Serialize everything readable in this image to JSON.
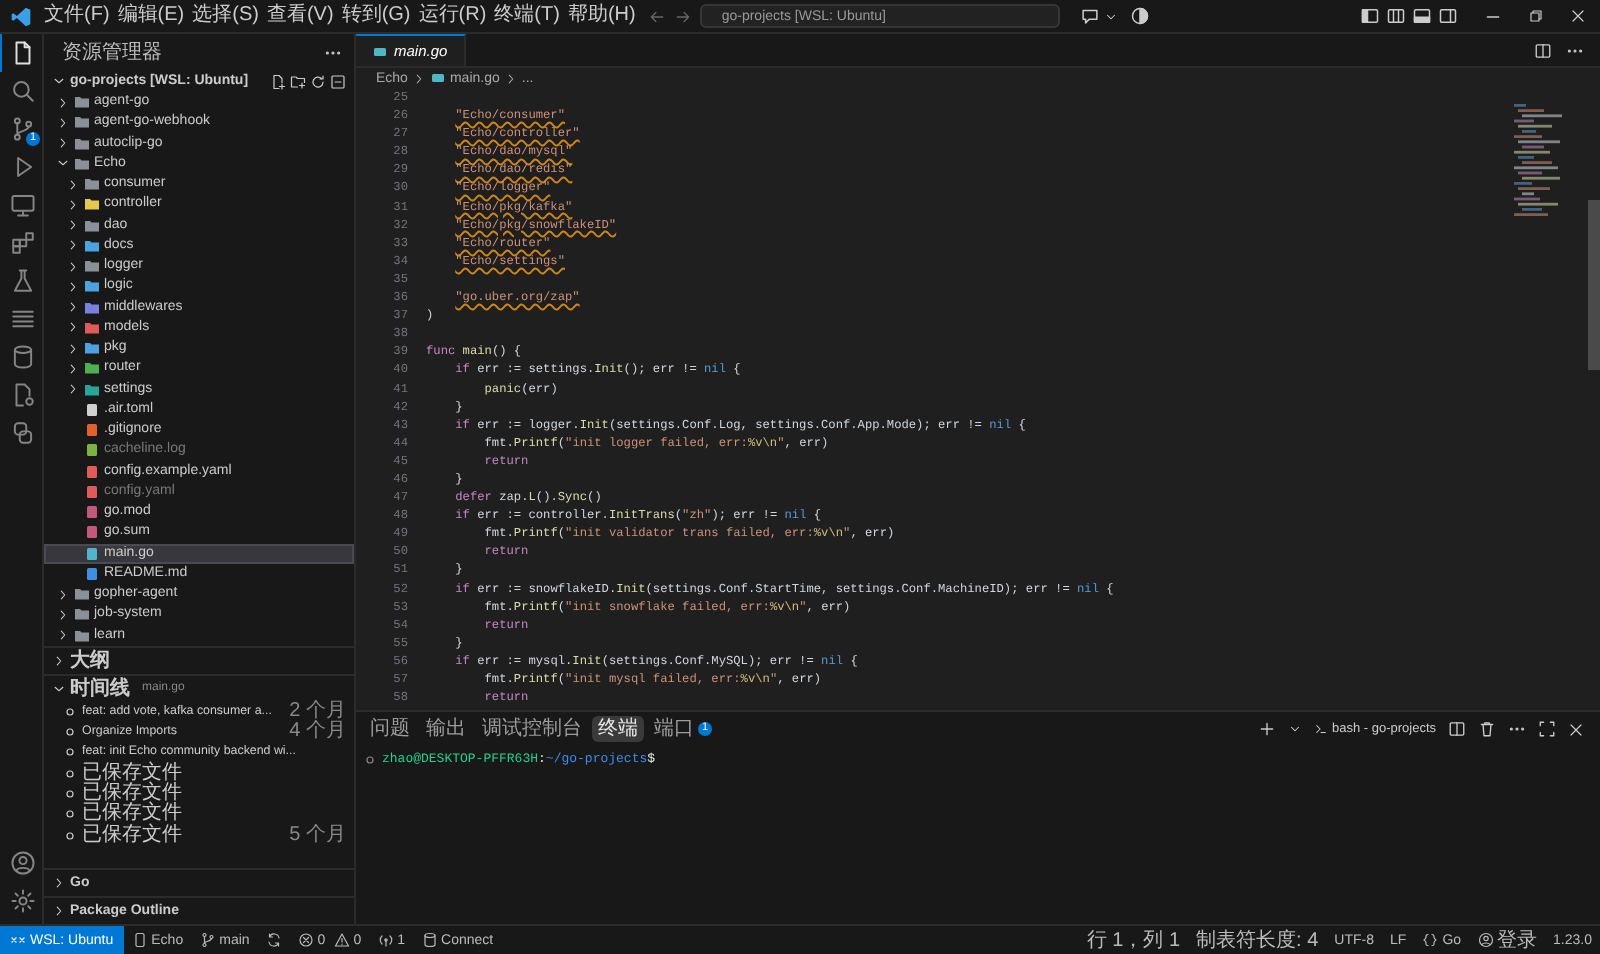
{
  "title_bar": {
    "menu": [
      "文件(F)",
      "编辑(E)",
      "选择(S)",
      "查看(V)",
      "转到(G)",
      "运行(R)",
      "终端(T)",
      "帮助(H)"
    ],
    "command_center": "go-projects [WSL: Ubuntu]"
  },
  "activity_bar": {
    "top": [
      {
        "kind": "explorer",
        "selected": true
      },
      {
        "kind": "search",
        "selected": false
      },
      {
        "kind": "source-control",
        "selected": false,
        "badge": "1"
      },
      {
        "kind": "run-debug",
        "selected": false
      },
      {
        "kind": "remote-explorer",
        "selected": false
      },
      {
        "kind": "extensions",
        "selected": false
      },
      {
        "kind": "testing",
        "selected": false
      },
      {
        "kind": "list",
        "selected": false
      },
      {
        "kind": "database",
        "selected": false
      },
      {
        "kind": "file-settings",
        "selected": false
      },
      {
        "kind": "two-squares",
        "selected": false
      }
    ],
    "bottom": [
      {
        "kind": "account",
        "selected": false
      },
      {
        "kind": "settings",
        "selected": false
      }
    ]
  },
  "sidebar": {
    "title": "资源管理器",
    "workspace": {
      "label": "go-projects [WSL: Ubuntu]",
      "expanded": true
    },
    "tree": [
      {
        "label": "agent-go",
        "kind": "folder",
        "color": "#8a8f98",
        "expanded": false,
        "selected": false,
        "ignored": false
      },
      {
        "label": "agent-go-webhook",
        "kind": "folder",
        "color": "#8a8f98",
        "expanded": false,
        "selected": false,
        "ignored": false
      },
      {
        "label": "autoclip-go",
        "kind": "folder",
        "color": "#8a8f98",
        "expanded": false,
        "selected": false,
        "ignored": false
      },
      {
        "label": "Echo",
        "kind": "folder",
        "color": "#8a8f98",
        "expanded": true,
        "selected": false,
        "ignored": false,
        "children": [
          {
            "label": "consumer",
            "kind": "folder",
            "color": "#8a8f98",
            "expanded": false,
            "selected": false,
            "ignored": false
          },
          {
            "label": "controller",
            "kind": "folder",
            "color": "#e6c84c",
            "expanded": false,
            "selected": false,
            "ignored": false
          },
          {
            "label": "dao",
            "kind": "folder",
            "color": "#8a8f98",
            "expanded": false,
            "selected": false,
            "ignored": false
          },
          {
            "label": "docs",
            "kind": "folder",
            "color": "#4aa3df",
            "expanded": false,
            "selected": false,
            "ignored": false
          },
          {
            "label": "logger",
            "kind": "folder",
            "color": "#8a8f98",
            "expanded": false,
            "selected": false,
            "ignored": false
          },
          {
            "label": "logic",
            "kind": "folder",
            "color": "#4aa3df",
            "expanded": false,
            "selected": false,
            "ignored": false
          },
          {
            "label": "middlewares",
            "kind": "folder",
            "color": "#7b7fe0",
            "expanded": false,
            "selected": false,
            "ignored": false
          },
          {
            "label": "models",
            "kind": "folder",
            "color": "#e05a5a",
            "expanded": false,
            "selected": false,
            "ignored": false
          },
          {
            "label": "pkg",
            "kind": "folder",
            "color": "#4aa3df",
            "expanded": false,
            "selected": false,
            "ignored": false
          },
          {
            "label": "router",
            "kind": "folder",
            "color": "#4caf50",
            "expanded": false,
            "selected": false,
            "ignored": false
          },
          {
            "label": "settings",
            "kind": "folder",
            "color": "#26a69a",
            "expanded": false,
            "selected": false,
            "ignored": false
          },
          {
            "label": ".air.toml",
            "kind": "file",
            "color": "#d0d0d0",
            "selected": false,
            "ignored": false
          },
          {
            "label": ".gitignore",
            "kind": "file",
            "color": "#e2622d",
            "selected": false,
            "ignored": false
          },
          {
            "label": "cacheline.log",
            "kind": "file",
            "color": "#7cb342",
            "selected": false,
            "ignored": true
          },
          {
            "label": "config.example.yaml",
            "kind": "file",
            "color": "#e05a5a",
            "selected": false,
            "ignored": false
          },
          {
            "label": "config.yaml",
            "kind": "file",
            "color": "#e05a5a",
            "selected": false,
            "ignored": true
          },
          {
            "label": "go.mod",
            "kind": "file",
            "color": "#c2587a",
            "selected": false,
            "ignored": false
          },
          {
            "label": "go.sum",
            "kind": "file",
            "color": "#c2587a",
            "selected": false,
            "ignored": false
          },
          {
            "label": "main.go",
            "kind": "file",
            "color": "#4fb6c8",
            "selected": true,
            "ignored": false
          },
          {
            "label": "README.md",
            "kind": "file",
            "color": "#3d8fe0",
            "selected": false,
            "ignored": false
          }
        ]
      },
      {
        "label": "gopher-agent",
        "kind": "folder",
        "color": "#8a8f98",
        "expanded": false,
        "selected": false,
        "ignored": false
      },
      {
        "label": "job-system",
        "kind": "folder",
        "color": "#8a8f98",
        "expanded": false,
        "selected": false,
        "ignored": false
      },
      {
        "label": "learn",
        "kind": "folder",
        "color": "#8a8f98",
        "expanded": false,
        "selected": false,
        "ignored": false
      }
    ],
    "sections": [
      {
        "label": "大纲",
        "expanded": false
      },
      {
        "label": "时间线",
        "detail": "main.go",
        "expanded": true,
        "entries": [
          {
            "label": "feat: add vote, kafka consumer a...",
            "time": "2 个月"
          },
          {
            "label": "Organize Imports",
            "time": "4 个月"
          },
          {
            "label": "feat: init Echo community backend wi..."
          },
          {
            "label": "已保存文件"
          },
          {
            "label": "已保存文件"
          },
          {
            "label": "已保存文件"
          },
          {
            "label": "已保存文件",
            "time": "5 个月"
          }
        ]
      },
      {
        "label": "Go",
        "expanded": false
      },
      {
        "label": "Package Outline",
        "expanded": false
      }
    ]
  },
  "editor": {
    "tabs": [
      {
        "label": "main.go",
        "selected": true,
        "preview": true
      }
    ],
    "breadcrumb": [
      {
        "kind": "folder",
        "label": "Echo"
      },
      {
        "kind": "file",
        "label": "main.go"
      },
      {
        "kind": "symbol",
        "label": "..."
      }
    ],
    "lines": [
      {
        "num": "25"
      },
      {
        "num": "26",
        "tokens": [
          {
            "kind": "import",
            "text": "\t\"Echo/consumer\""
          }
        ]
      },
      {
        "num": "27",
        "tokens": [
          {
            "kind": "import",
            "text": "\t\"Echo/controller\""
          }
        ]
      },
      {
        "num": "28",
        "tokens": [
          {
            "kind": "import",
            "text": "\t\"Echo/dao/mysql\""
          }
        ]
      },
      {
        "num": "29",
        "tokens": [
          {
            "kind": "import",
            "text": "\t\"Echo/dao/redis\""
          }
        ]
      },
      {
        "num": "30",
        "tokens": [
          {
            "kind": "import",
            "text": "\t\"Echo/logger\""
          }
        ]
      },
      {
        "num": "31",
        "tokens": [
          {
            "kind": "import",
            "text": "\t\"Echo/pkg/kafka\""
          }
        ]
      },
      {
        "num": "32",
        "tokens": [
          {
            "kind": "import",
            "text": "\t\"Echo/pkg/snowflakeID\""
          }
        ]
      },
      {
        "num": "33",
        "tokens": [
          {
            "kind": "import",
            "text": "\t\"Echo/router\""
          }
        ]
      },
      {
        "num": "34",
        "tokens": [
          {
            "kind": "import",
            "text": "\t\"Echo/settings\""
          }
        ]
      },
      {
        "num": "35"
      },
      {
        "num": "36",
        "tokens": [
          {
            "kind": "import",
            "text": "\t\"go.uber.org/zap\""
          }
        ]
      },
      {
        "num": "37",
        "tokens": [
          {
            "kind": "plain",
            "text": ")"
          }
        ]
      },
      {
        "num": "38"
      },
      {
        "num": "39",
        "tokens": [
          {
            "kind": "keyword",
            "text": "func "
          },
          {
            "kind": "func",
            "text": "main"
          },
          {
            "kind": "plain",
            "text": "() {"
          }
        ]
      },
      {
        "num": "40",
        "tokens": [
          {
            "kind": "keyword",
            "text": "\tif "
          },
          {
            "kind": "plain",
            "text": "err := settings."
          },
          {
            "kind": "func",
            "text": "Init"
          },
          {
            "kind": "plain",
            "text": "(); err != "
          },
          {
            "kind": "constant",
            "text": "nil"
          },
          {
            "kind": "plain",
            "text": " {"
          }
        ]
      },
      {
        "num": "41",
        "tokens": [
          {
            "kind": "func",
            "text": "\t\tpanic"
          },
          {
            "kind": "plain",
            "text": "(err)"
          }
        ]
      },
      {
        "num": "42",
        "tokens": [
          {
            "kind": "plain",
            "text": "\t}"
          }
        ]
      },
      {
        "num": "43",
        "tokens": [
          {
            "kind": "keyword",
            "text": "\tif "
          },
          {
            "kind": "plain",
            "text": "err := logger."
          },
          {
            "kind": "func",
            "text": "Init"
          },
          {
            "kind": "plain",
            "text": "(settings.Conf.Log, settings.Conf.App.Mode); err != "
          },
          {
            "kind": "constant",
            "text": "nil"
          },
          {
            "kind": "plain",
            "text": " {"
          }
        ]
      },
      {
        "num": "44",
        "tokens": [
          {
            "kind": "plain",
            "text": "\t\tfmt."
          },
          {
            "kind": "func",
            "text": "Printf"
          },
          {
            "kind": "plain",
            "text": "("
          },
          {
            "kind": "string",
            "text": "\"init logger failed, err:"
          },
          {
            "kind": "escape",
            "text": "%v\\n"
          },
          {
            "kind": "string",
            "text": "\""
          },
          {
            "kind": "plain",
            "text": ", err)"
          }
        ]
      },
      {
        "num": "45",
        "tokens": [
          {
            "kind": "keyword",
            "text": "\t\treturn"
          }
        ]
      },
      {
        "num": "46",
        "tokens": [
          {
            "kind": "plain",
            "text": "\t}"
          }
        ]
      },
      {
        "num": "47",
        "tokens": [
          {
            "kind": "keyword",
            "text": "\tdefer "
          },
          {
            "kind": "plain",
            "text": "zap."
          },
          {
            "kind": "func",
            "text": "L"
          },
          {
            "kind": "plain",
            "text": "()."
          },
          {
            "kind": "func",
            "text": "Sync"
          },
          {
            "kind": "plain",
            "text": "()"
          }
        ]
      },
      {
        "num": "48",
        "tokens": [
          {
            "kind": "keyword",
            "text": "\tif "
          },
          {
            "kind": "plain",
            "text": "err := controller."
          },
          {
            "kind": "func",
            "text": "InitTrans"
          },
          {
            "kind": "plain",
            "text": "("
          },
          {
            "kind": "string",
            "text": "\"zh\""
          },
          {
            "kind": "plain",
            "text": "); err != "
          },
          {
            "kind": "constant",
            "text": "nil"
          },
          {
            "kind": "plain",
            "text": " {"
          }
        ]
      },
      {
        "num": "49",
        "tokens": [
          {
            "kind": "plain",
            "text": "\t\tfmt."
          },
          {
            "kind": "func",
            "text": "Printf"
          },
          {
            "kind": "plain",
            "text": "("
          },
          {
            "kind": "string",
            "text": "\"init validator trans failed, err:"
          },
          {
            "kind": "escape",
            "text": "%v\\n"
          },
          {
            "kind": "string",
            "text": "\""
          },
          {
            "kind": "plain",
            "text": ", err)"
          }
        ]
      },
      {
        "num": "50",
        "tokens": [
          {
            "kind": "keyword",
            "text": "\t\treturn"
          }
        ]
      },
      {
        "num": "51",
        "tokens": [
          {
            "kind": "plain",
            "text": "\t}"
          }
        ]
      },
      {
        "num": "52",
        "tokens": [
          {
            "kind": "keyword",
            "text": "\tif "
          },
          {
            "kind": "plain",
            "text": "err := snowflakeID."
          },
          {
            "kind": "func",
            "text": "Init"
          },
          {
            "kind": "plain",
            "text": "(settings.Conf.StartTime, settings.Conf.MachineID); err != "
          },
          {
            "kind": "constant",
            "text": "nil"
          },
          {
            "kind": "plain",
            "text": " {"
          }
        ]
      },
      {
        "num": "53",
        "tokens": [
          {
            "kind": "plain",
            "text": "\t\tfmt."
          },
          {
            "kind": "func",
            "text": "Printf"
          },
          {
            "kind": "plain",
            "text": "("
          },
          {
            "kind": "string",
            "text": "\"init snowflake failed, err:"
          },
          {
            "kind": "escape",
            "text": "%v\\n"
          },
          {
            "kind": "string",
            "text": "\""
          },
          {
            "kind": "plain",
            "text": ", err)"
          }
        ]
      },
      {
        "num": "54",
        "tokens": [
          {
            "kind": "keyword",
            "text": "\t\treturn"
          }
        ]
      },
      {
        "num": "55",
        "tokens": [
          {
            "kind": "plain",
            "text": "\t}"
          }
        ]
      },
      {
        "num": "56",
        "tokens": [
          {
            "kind": "keyword",
            "text": "\tif "
          },
          {
            "kind": "plain",
            "text": "err := mysql."
          },
          {
            "kind": "func",
            "text": "Init"
          },
          {
            "kind": "plain",
            "text": "(settings.Conf.MySQL); err != "
          },
          {
            "kind": "constant",
            "text": "nil"
          },
          {
            "kind": "plain",
            "text": " {"
          }
        ]
      },
      {
        "num": "57",
        "tokens": [
          {
            "kind": "plain",
            "text": "\t\tfmt."
          },
          {
            "kind": "func",
            "text": "Printf"
          },
          {
            "kind": "plain",
            "text": "("
          },
          {
            "kind": "string",
            "text": "\"init mysql failed, err:"
          },
          {
            "kind": "escape",
            "text": "%v\\n"
          },
          {
            "kind": "string",
            "text": "\""
          },
          {
            "kind": "plain",
            "text": ", err)"
          }
        ]
      },
      {
        "num": "58",
        "tokens": [
          {
            "kind": "keyword",
            "text": "\t\treturn"
          }
        ]
      }
    ]
  },
  "panel": {
    "tabs": [
      {
        "label": "问题",
        "selected": false
      },
      {
        "label": "输出",
        "selected": false
      },
      {
        "label": "调试控制台",
        "selected": false
      },
      {
        "label": "终端",
        "selected": true
      },
      {
        "label": "端口",
        "selected": false,
        "badge": "1"
      }
    ],
    "terminal_name": "bash - go-projects",
    "prompt": [
      {
        "kind": "user",
        "text": "zhao@DESKTOP-PFFR63H"
      },
      {
        "kind": "plain",
        "text": ":"
      },
      {
        "kind": "path",
        "text": "~/go-projects"
      },
      {
        "kind": "plain",
        "text": "$"
      }
    ]
  },
  "status_bar": {
    "left": [
      {
        "kind": "remote",
        "label": "WSL: Ubuntu"
      },
      {
        "kind": "project",
        "label": "Echo"
      },
      {
        "kind": "branch",
        "label": "main"
      },
      {
        "kind": "sync"
      },
      {
        "kind": "problems",
        "errors": "0",
        "warnings": "0"
      },
      {
        "kind": "ports",
        "label": "1"
      },
      {
        "kind": "database",
        "label": "Connect"
      }
    ],
    "right": [
      {
        "kind": "text",
        "label": "行 1，列 1"
      },
      {
        "kind": "text",
        "label": "制表符长度: 4"
      },
      {
        "kind": "text",
        "label": "UTF-8"
      },
      {
        "kind": "text",
        "label": "LF"
      },
      {
        "kind": "language",
        "label": "Go"
      },
      {
        "kind": "account",
        "label": "登录"
      },
      {
        "kind": "text",
        "label": "1.23.0"
      }
    ]
  }
}
